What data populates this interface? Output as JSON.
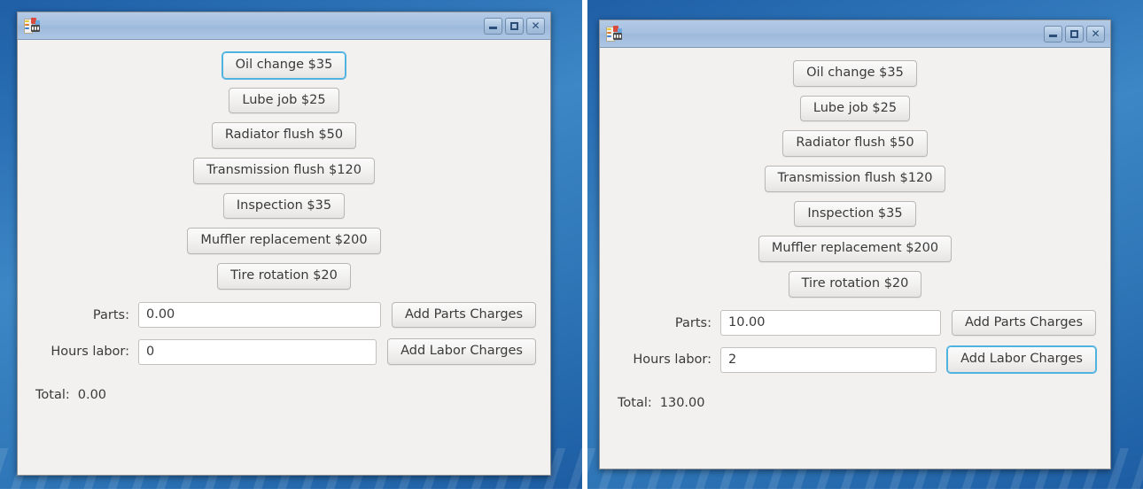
{
  "app": {
    "icon_name": "paint-palette-icon",
    "title": ""
  },
  "titlebar": {
    "minimize_label": "Minimize",
    "maximize_label": "Maximize",
    "close_label": "✕"
  },
  "services": [
    {
      "label": "Oil change $35",
      "price": 35
    },
    {
      "label": "Lube job $25",
      "price": 25
    },
    {
      "label": "Radiator flush $50",
      "price": 50
    },
    {
      "label": "Transmission flush $120",
      "price": 120
    },
    {
      "label": "Inspection $35",
      "price": 35
    },
    {
      "label": "Muffler replacement $200",
      "price": 200
    },
    {
      "label": "Tire rotation $20",
      "price": 20
    }
  ],
  "form": {
    "parts_label": "Parts:",
    "labor_label": "Hours labor:",
    "add_parts_label": "Add Parts Charges",
    "add_labor_label": "Add Labor Charges",
    "total_label": "Total:"
  },
  "windows": {
    "left": {
      "parts_value": "0.00",
      "labor_value": "0",
      "total_value": "0.00",
      "focused_element": "service-oil-change"
    },
    "right": {
      "parts_value": "10.00",
      "labor_value": "2",
      "total_value": "130.00",
      "focused_element": "add-labor-charges-button"
    }
  },
  "colors": {
    "focus_ring": "#4fb3e0",
    "desktop_blue": "#2a6fb4",
    "titlebar_blue": "#a6c0e0",
    "button_face": "#f2f1f0",
    "text": "#3a3a3a"
  }
}
